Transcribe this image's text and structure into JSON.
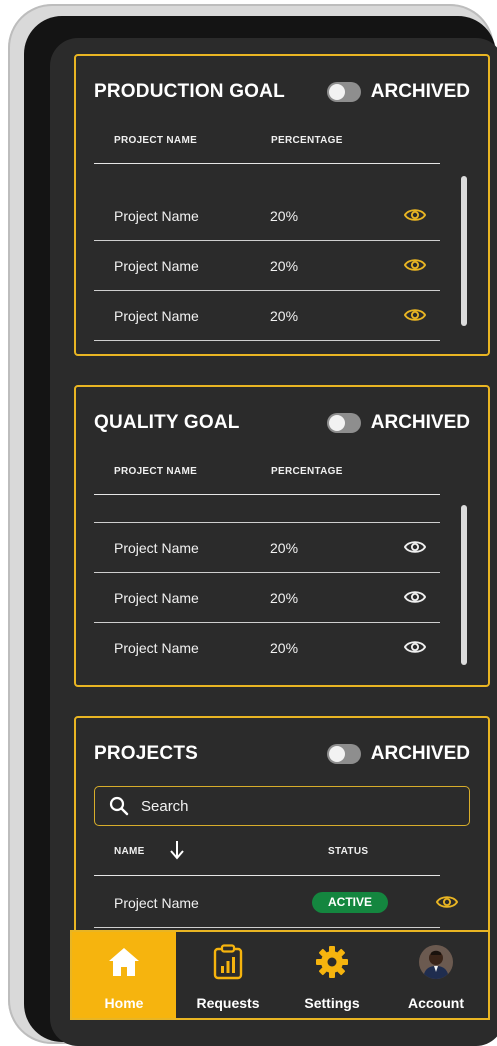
{
  "production": {
    "title": "PRODUCTION GOAL",
    "archived_label": "ARCHIVED",
    "columns": [
      "PROJECT NAME",
      "PERCENTAGE"
    ],
    "rows": [
      {
        "name": "Project Name",
        "percentage": "20%"
      },
      {
        "name": "Project Name",
        "percentage": "20%"
      },
      {
        "name": "Project Name",
        "percentage": "20%"
      }
    ]
  },
  "quality": {
    "title": "QUALITY GOAL",
    "archived_label": "ARCHIVED",
    "columns": [
      "PROJECT NAME",
      "PERCENTAGE"
    ],
    "rows": [
      {
        "name": "Project Name",
        "percentage": "20%"
      },
      {
        "name": "Project Name",
        "percentage": "20%"
      },
      {
        "name": "Project Name",
        "percentage": "20%"
      }
    ]
  },
  "projects": {
    "title": "PROJECTS",
    "archived_label": "ARCHIVED",
    "search_placeholder": "Search",
    "columns": [
      "NAME",
      "STATUS"
    ],
    "rows": [
      {
        "name": "Project Name",
        "status": "ACTIVE"
      }
    ]
  },
  "nav": {
    "items": [
      {
        "label": "Home",
        "icon": "home-icon",
        "active": true
      },
      {
        "label": "Requests",
        "icon": "clipboard-chart-icon",
        "active": false
      },
      {
        "label": "Settings",
        "icon": "gear-icon",
        "active": false
      },
      {
        "label": "Account",
        "icon": "avatar",
        "active": false
      }
    ]
  },
  "colors": {
    "accent": "#e9b523",
    "active_tab": "#f6b40e",
    "status_active": "#14863f",
    "background": "#2b2b2b"
  }
}
